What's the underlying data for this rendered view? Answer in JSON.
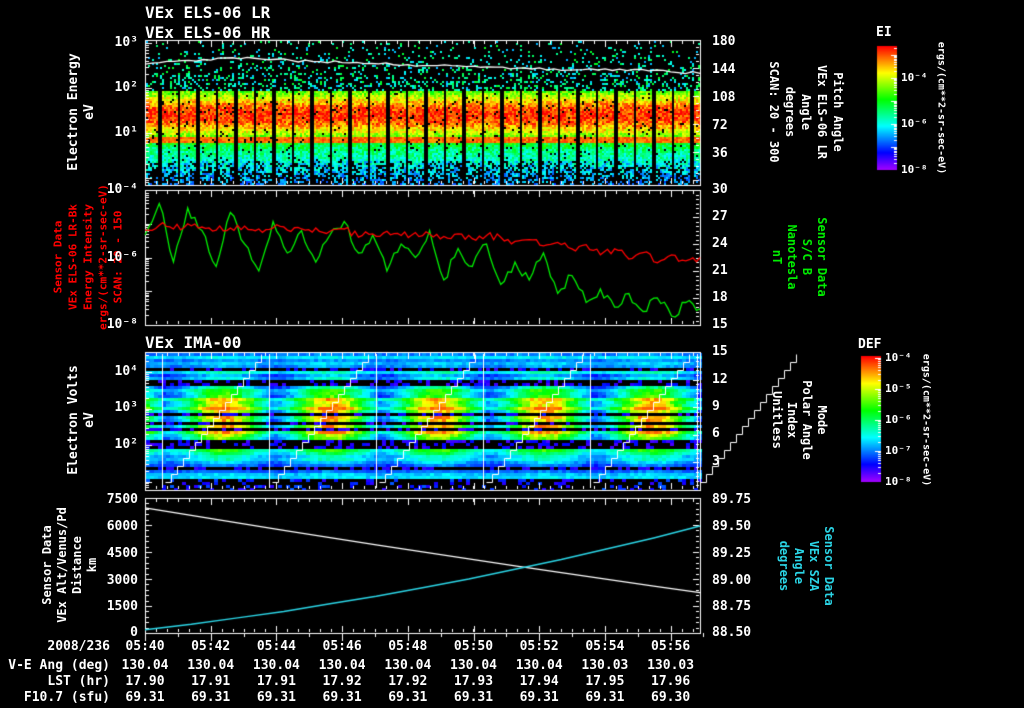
{
  "titles": {
    "els_lr": "VEx ELS-06 LR",
    "els_hr": "VEx ELS-06 HR",
    "ima": "VEx IMA-00"
  },
  "panels": [
    {
      "id": "els-spectrogram",
      "left_label_lines": [
        "Electron Energy",
        "eV"
      ],
      "left_ticks": [
        "10³",
        "10²",
        "10¹"
      ],
      "right_ticks": [
        "180",
        "144",
        "108",
        "72",
        "36"
      ],
      "right_label_lines": [
        "Pitch Angle",
        "VEx ELS-06 LR",
        "Angle",
        "degrees",
        "SCAN: 20 - 300"
      ]
    },
    {
      "id": "intensity-bfield",
      "left_label_lines": [
        "Sensor Data",
        "VEx ELS-06 LR-Bk",
        "Energy Intensity",
        "ergs/(cm**2-sr-sec-eV)",
        "SCAN: 20 - 150"
      ],
      "left_label_color": "#ff0000",
      "left_ticks": [
        "10⁻⁴",
        "10⁻⁶",
        "10⁻⁸"
      ],
      "right_ticks": [
        "30",
        "27",
        "24",
        "21",
        "18",
        "15"
      ],
      "right_label_lines": [
        "Sensor Data",
        "S/C B",
        "Nanotesla",
        "nT"
      ],
      "right_label_color": "#00ee00"
    },
    {
      "id": "ima-spectrogram",
      "left_label_lines": [
        "Electron Volts",
        "eV"
      ],
      "left_ticks": [
        "10⁴",
        "10³",
        "10²"
      ],
      "right_ticks": [
        "15",
        "12",
        "9",
        "6",
        "3"
      ],
      "right_label_lines": [
        "Mode",
        "Polar Angle",
        "Index",
        "Unitless"
      ]
    },
    {
      "id": "ephemeris",
      "left_label_lines": [
        "Sensor Data",
        "VEx Alt/Venus/Pd",
        "Distance",
        "km"
      ],
      "left_ticks": [
        "7500",
        "6000",
        "4500",
        "3000",
        "1500",
        "0"
      ],
      "right_ticks": [
        "89.75",
        "89.50",
        "89.25",
        "89.00",
        "88.75",
        "88.50"
      ],
      "right_label_lines": [
        "Sensor Data",
        "VEx SZA",
        "Angle",
        "degrees"
      ],
      "right_label_color": "#2bd5e6"
    }
  ],
  "colorbars": [
    {
      "title": "EI",
      "ticks": [
        "10⁻⁴",
        "10⁻⁶",
        "10⁻⁸"
      ],
      "units": "ergs/(cm**2-sr-sec-eV)"
    },
    {
      "title": "DEF",
      "ticks": [
        "10⁻⁴",
        "10⁻⁵",
        "10⁻⁶",
        "10⁻⁷",
        "10⁻⁸"
      ],
      "units": "ergs/(cm**2-sr-sec-eV)"
    }
  ],
  "footer": {
    "date_label": "2008/236",
    "times": [
      "05:40",
      "05:42",
      "05:44",
      "05:46",
      "05:48",
      "05:50",
      "05:52",
      "05:54",
      "05:56"
    ],
    "rows": [
      {
        "label": "V-E Ang (deg)",
        "values": [
          "130.04",
          "130.04",
          "130.04",
          "130.04",
          "130.04",
          "130.04",
          "130.04",
          "130.03",
          "130.03"
        ]
      },
      {
        "label": "LST (hr)",
        "values": [
          "17.90",
          "17.91",
          "17.91",
          "17.92",
          "17.92",
          "17.93",
          "17.94",
          "17.95",
          "17.96"
        ]
      },
      {
        "label": "F10.7 (sfu)",
        "values": [
          "69.31",
          "69.31",
          "69.31",
          "69.31",
          "69.31",
          "69.31",
          "69.31",
          "69.31",
          "69.30"
        ]
      }
    ]
  },
  "colors": {
    "background": "#000000",
    "text": "#ffffff",
    "red_accent": "#ff0000",
    "green_accent": "#00ee00",
    "cyan_accent": "#2bd5e6"
  },
  "chart_data": [
    {
      "id": "els_spectrogram",
      "type": "heatmap",
      "panel": 1,
      "y_scale": "log",
      "y_unit": "eV",
      "y_tick_values_ev": [
        1000,
        100,
        10
      ],
      "color_scale": "EI",
      "intense_band_ev": {
        "from": 3,
        "to": 60,
        "peak": 10
      },
      "right_axis": {
        "name": "Pitch Angle",
        "unit": "degrees",
        "ylim": [
          0,
          180
        ],
        "ticks": [
          180,
          144,
          108,
          72,
          36
        ]
      },
      "overlay_trace_ev": [
        340,
        390,
        430,
        470,
        440,
        410,
        385,
        360,
        345,
        330,
        315,
        300,
        290,
        278,
        265,
        255,
        245,
        258,
        228,
        212
      ],
      "periodic_data_gaps": true
    },
    {
      "id": "els_intensity_and_b",
      "type": "line",
      "panel": 2,
      "series": [
        {
          "name": "VEx ELS-06 LR-Bk Energy Intensity",
          "unit": "ergs/(cm**2-sr-sec-eV)",
          "color": "#ff0000",
          "axis": "left-log",
          "ylim": [
            1e-08,
            0.0001
          ],
          "values": [
            6.5e-06,
            9e-06,
            7e-06,
            1e-05,
            8e-06,
            6.5e-06,
            7.5e-06,
            8.5e-06,
            7e-06,
            7.5e-06,
            6.5e-06,
            7e-06,
            7.5e-06,
            6e-06,
            7e-06,
            4e-06,
            5e-06,
            6e-06,
            4.5e-06,
            5.5e-06,
            5e-06,
            4.2e-06,
            5e-06,
            3.6e-06,
            4.5e-06,
            4e-06,
            3e-06,
            3.4e-06,
            2.2e-06,
            2.8e-06,
            1.8e-06,
            2.4e-06,
            1.2e-06,
            1.8e-06,
            9e-07,
            1.4e-06,
            7e-07,
            1.2e-06,
            8e-07,
            1e-06
          ]
        },
        {
          "name": "S/C B",
          "unit": "nT",
          "color": "#00ee00",
          "axis": "right-linear",
          "ylim": [
            15,
            30
          ],
          "values": [
            25,
            28.5,
            22,
            28,
            25.5,
            21.5,
            27.5,
            24,
            21,
            26.5,
            23,
            25.5,
            22,
            25,
            26.5,
            23,
            25,
            21,
            24,
            22.5,
            25.5,
            20,
            23.5,
            21.5,
            24,
            19.5,
            22,
            20,
            23,
            18.5,
            20.5,
            17.5,
            19,
            17,
            18.5,
            16.5,
            18,
            16,
            17.5,
            16.8
          ]
        }
      ]
    },
    {
      "id": "ima_spectrogram",
      "type": "heatmap",
      "panel": 3,
      "y_scale": "log",
      "y_unit": "eV",
      "y_tick_values_ev": [
        10000,
        1000,
        100
      ],
      "color_scale": "DEF",
      "scan_count": 5,
      "ion_beam_ev": {
        "from": 150,
        "to": 1500,
        "peak": 450
      },
      "right_axis": {
        "name": "Polar Angle Index",
        "ylim": [
          0,
          15
        ],
        "ticks": [
          15,
          12,
          9,
          6,
          3
        ]
      },
      "overlays": [
        "white scan-boundary vertical lines",
        "white staircase elevation ramps"
      ]
    },
    {
      "id": "ephemeris",
      "type": "line",
      "panel": 4,
      "series": [
        {
          "name": "VEx Alt/Venus/Pd Distance",
          "unit": "km",
          "color": "#ffffff",
          "axis": "left-linear",
          "ylim": [
            0,
            7500
          ],
          "values": [
            6950,
            6530,
            6115,
            5705,
            5300,
            4900,
            4505,
            4115,
            3730,
            3350,
            2975,
            2605,
            2240
          ]
        },
        {
          "name": "VEx SZA",
          "unit": "degrees",
          "color": "#2bd5e6",
          "axis": "right-linear",
          "ylim": [
            88.5,
            89.75
          ],
          "values": [
            88.53,
            88.58,
            88.64,
            88.7,
            88.77,
            88.84,
            88.92,
            89.0,
            89.09,
            89.18,
            89.28,
            89.38,
            89.49
          ]
        }
      ]
    }
  ]
}
